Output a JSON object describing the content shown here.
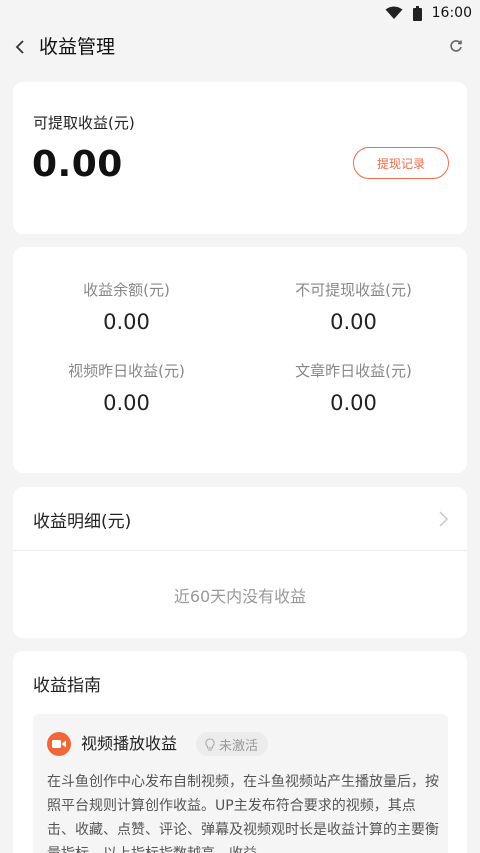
{
  "status_bar": {
    "time": "16:00",
    "icons": [
      "wifi-icon",
      "battery-icon"
    ]
  },
  "app_bar": {
    "title": "收益管理",
    "back_icon": "chevron-left-icon",
    "refresh_icon": "refresh-icon"
  },
  "withdrawable": {
    "label": "可提取收益(元)",
    "amount": "0.00",
    "record_button": "提现记录"
  },
  "stats": [
    {
      "label": "收益余额(元)",
      "value": "0.00"
    },
    {
      "label": "不可提现收益(元)",
      "value": "0.00"
    },
    {
      "label": "视频昨日收益(元)",
      "value": "0.00"
    },
    {
      "label": "文章昨日收益(元)",
      "value": "0.00"
    }
  ],
  "detail": {
    "title": "收益明细(元)",
    "empty_text": "近60天内没有收益"
  },
  "guide": {
    "title": "收益指南",
    "item": {
      "icon": "video-camera-icon",
      "title": "视频播放收益",
      "badge_icon": "bulb-icon",
      "badge": "未激活",
      "description": "在斗鱼创作中心发布自制视频，在斗鱼视频站产生播放量后，按照平台规则计算创作收益。UP主发布符合要求的视频，其点击、收藏、点赞、评论、弹幕及视频观时长是收益计算的主要衡量指标，以上指标指数越高，收益"
    }
  },
  "colors": {
    "accent": "#f26b4a",
    "background": "#f4f4f4",
    "card": "#ffffff",
    "icon_orange": "#f0673a"
  }
}
